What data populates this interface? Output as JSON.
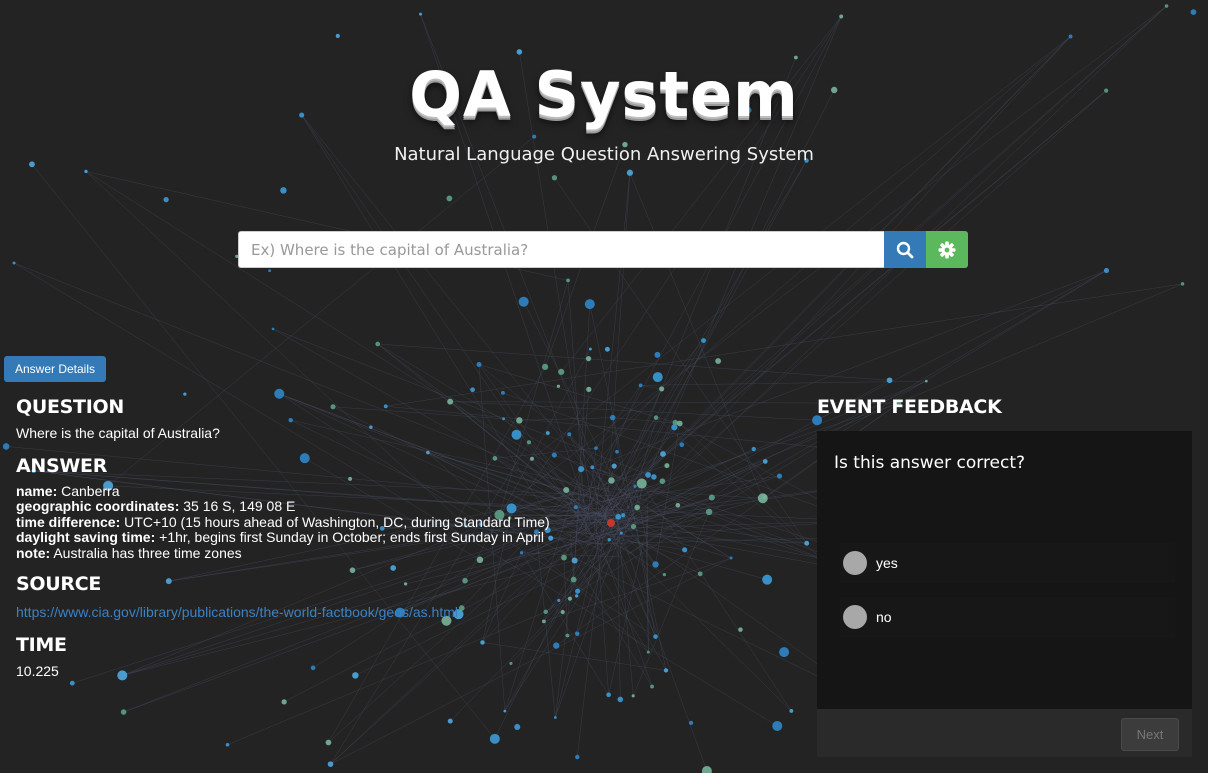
{
  "header": {
    "title": "QA System",
    "subtitle": "Natural Language Question Answering System"
  },
  "search": {
    "placeholder": "Ex) Where is the capital of Australia?",
    "search_icon": "search-icon",
    "settings_icon": "gear-icon",
    "search_color": "#337ab7",
    "settings_color": "#5cb85c"
  },
  "answer_details_button": "Answer Details",
  "question": {
    "heading": "QUESTION",
    "text": "Where is the capital of Australia?"
  },
  "answer": {
    "heading": "ANSWER",
    "fields": [
      {
        "label": "name:",
        "value": " Canberra"
      },
      {
        "label": "geographic coordinates:",
        "value": " 35 16 S, 149 08 E"
      },
      {
        "label": "time difference:",
        "value": " UTC+10 (15 hours ahead of Washington, DC, during Standard Time)"
      },
      {
        "label": "daylight saving time:",
        "value": " +1hr, begins first Sunday in October; ends first Sunday in April"
      },
      {
        "label": "note:",
        "value": " Australia has three time zones"
      }
    ]
  },
  "source": {
    "heading": "SOURCE",
    "url": "https://www.cia.gov/library/publications/the-world-factbook/geos/as.html"
  },
  "time": {
    "heading": "TIME",
    "value": "10.225"
  },
  "feedback": {
    "heading": "EVENT FEEDBACK",
    "question": "Is this answer correct?",
    "options": [
      "yes",
      "no"
    ],
    "next_label": "Next"
  }
}
